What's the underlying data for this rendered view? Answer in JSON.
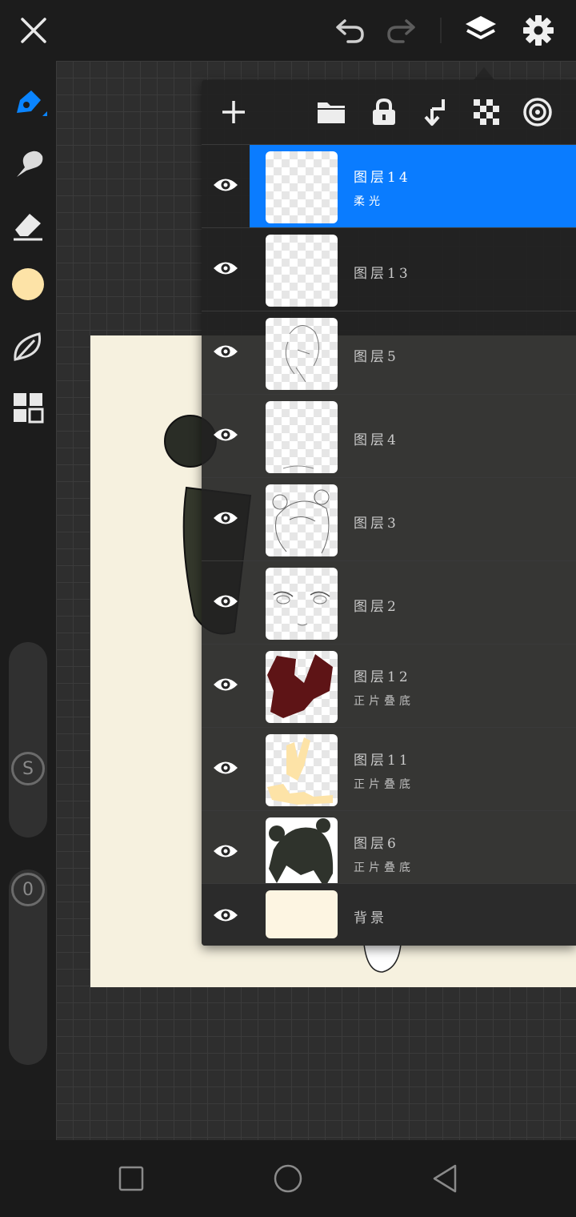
{
  "colors": {
    "accent": "#0a7cff",
    "current_color": "#fde3a7",
    "background_layer": "#fdf5e2",
    "paper": "#f6f1df"
  },
  "top_bar": {
    "icons": [
      "close-icon",
      "undo-icon",
      "redo-icon",
      "layers-icon",
      "settings-icon"
    ]
  },
  "left_tools": {
    "icons": [
      "pen-icon",
      "smudge-icon",
      "eraser-icon",
      "color-swatch",
      "leaf-icon",
      "grid-icon"
    ],
    "size_knob_label": "S",
    "opacity_knob_label": "0"
  },
  "layers_panel": {
    "toolbar_icons": [
      "add-icon",
      "folder-icon",
      "lock-icon",
      "merge-down-icon",
      "checker-icon",
      "blend-circle-icon"
    ],
    "layers": [
      {
        "name": "图层14",
        "mode": "柔光",
        "selected": true
      },
      {
        "name": "图层13",
        "mode": ""
      },
      {
        "name": "图层5",
        "mode": ""
      },
      {
        "name": "图层4",
        "mode": ""
      },
      {
        "name": "图层3",
        "mode": ""
      },
      {
        "name": "图层2",
        "mode": ""
      },
      {
        "name": "图层12",
        "mode": "正片叠底"
      },
      {
        "name": "图层11",
        "mode": "正片叠底"
      },
      {
        "name": "图层6",
        "mode": "正片叠底"
      },
      {
        "name": "背景",
        "mode": ""
      }
    ]
  },
  "nav_bar": {
    "icons": [
      "recent-apps-icon",
      "home-icon",
      "back-icon"
    ]
  }
}
